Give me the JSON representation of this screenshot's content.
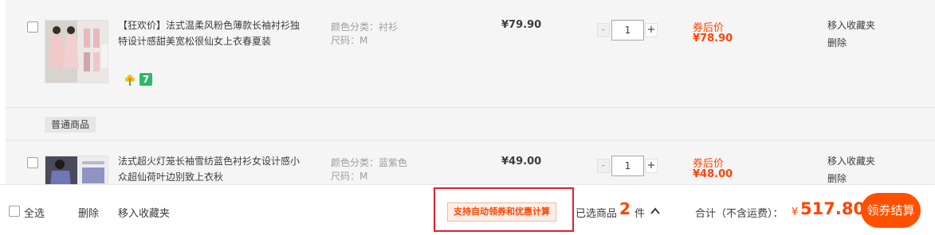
{
  "items": [
    {
      "title": "【狂欢价】法式温柔风粉色薄款长袖衬衫独特设计感甜美宽松很仙女上衣春夏装",
      "sku_color": "颜色分类：衬衫",
      "sku_size": "尺码：M",
      "price": "¥79.90",
      "quantity": "1",
      "coupon_label": "券后价",
      "coupon_price": "¥78.90",
      "op_fav": "移入收藏夹",
      "op_delete": "删除",
      "badge_seven": "7"
    },
    {
      "title": "法式超火灯笼长袖雪纺蓝色衬衫女设计感小众超仙荷叶边别致上衣秋",
      "sku_color": "颜色分类：蓝紫色",
      "sku_size": "尺码：M",
      "price": "¥49.00",
      "quantity": "1",
      "coupon_label": "券后价",
      "coupon_price": "¥48.00",
      "op_fav": "移入收藏夹",
      "op_delete": "删除"
    }
  ],
  "group_tag": "普通商品",
  "qty_minus": "-",
  "qty_plus": "+",
  "footer": {
    "select_all": "全选",
    "delete": "删除",
    "move_to_fav": "移入收藏夹",
    "promo": "支持自动领券和优惠计算",
    "selected_label": "已选商品",
    "selected_count": "2",
    "selected_unit": "件",
    "total_label": "合计（不含运费）：",
    "currency": "¥",
    "total": "517.80",
    "checkout": "领券结算"
  },
  "colors": {
    "accent": "#ff5000",
    "price_red": "#ff4400",
    "highlight_border": "#e0202a",
    "badge_green": "#2db96b"
  },
  "icons": [
    "checkbox-icon",
    "flower-icon",
    "seven-day-return-icon",
    "caret-up-icon"
  ]
}
